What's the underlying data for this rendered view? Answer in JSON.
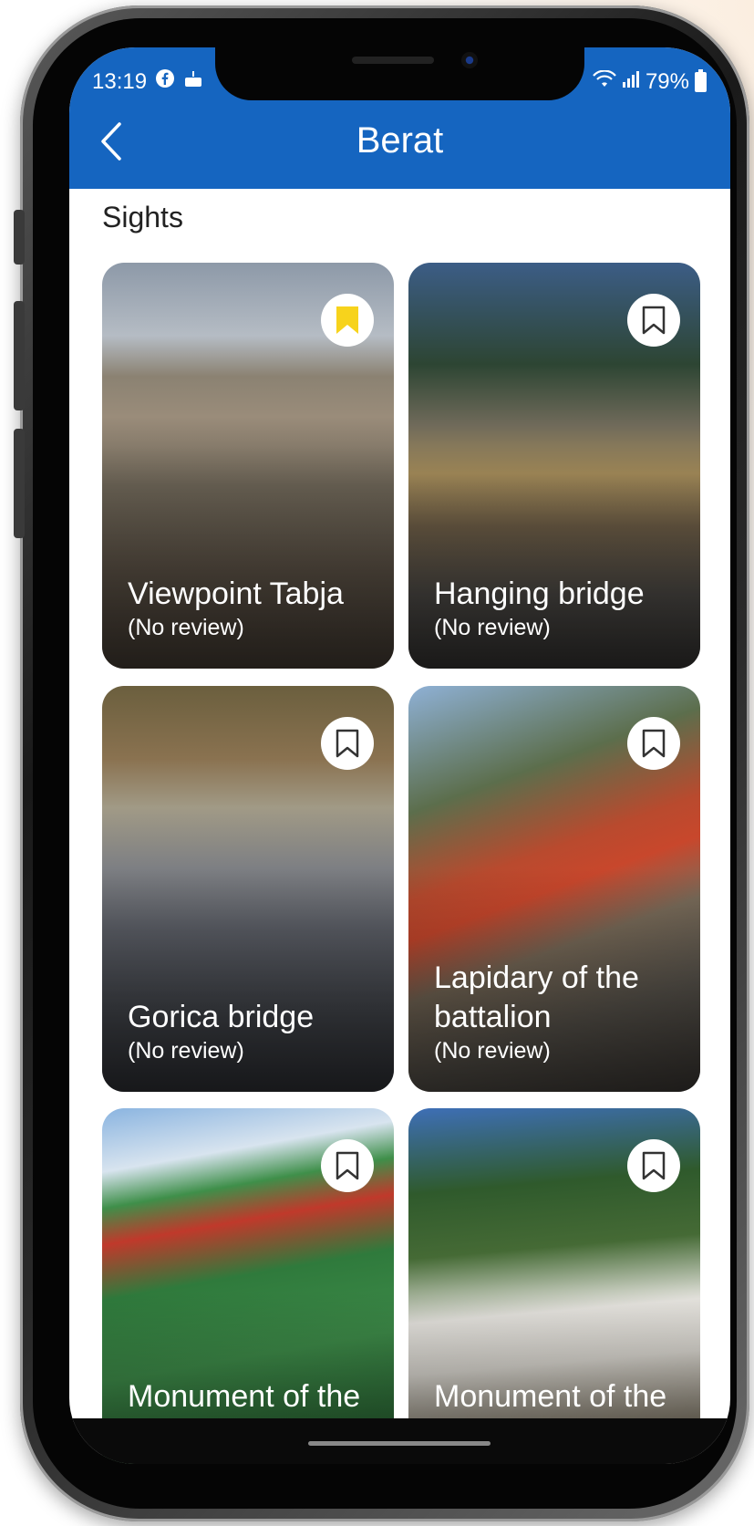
{
  "status": {
    "time": "13:19",
    "left_icons": [
      "facebook-icon",
      "cake-icon"
    ],
    "battery": "79%"
  },
  "header": {
    "title": "Berat",
    "back_icon": "chevron-left-icon"
  },
  "section": {
    "title": "Sights"
  },
  "cards": [
    {
      "title": "Viewpoint Tabja",
      "review": "(No review)",
      "bookmarked": true
    },
    {
      "title": "Hanging bridge",
      "review": "(No review)",
      "bookmarked": false
    },
    {
      "title": "Gorica bridge",
      "review": "(No review)",
      "bookmarked": false
    },
    {
      "title": "Lapidary of the battalion",
      "review": "(No review)",
      "bookmarked": false
    },
    {
      "title": "Monument of the liberation of",
      "review": "",
      "bookmarked": false
    },
    {
      "title": "Monument of the Martyrs of",
      "review": "",
      "bookmarked": false
    }
  ],
  "colors": {
    "appbar": "#1565c0",
    "bookmark_active": "#f7d31c",
    "bookmark_inactive": "#333333"
  }
}
